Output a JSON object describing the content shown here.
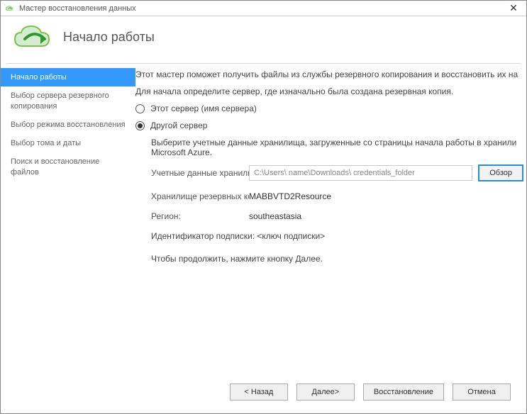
{
  "titlebar": {
    "title": "Мастер восстановления данных"
  },
  "header": {
    "heading": "Начало работы"
  },
  "sidebar": {
    "steps": [
      "Начало работы",
      "Выбор сервера резервного копирования",
      "Выбор режима восстановления",
      "Выбор тома и даты",
      "Поиск и восстановление файлов"
    ]
  },
  "content": {
    "intro": "Этот мастер поможет получить файлы из службы резервного копирования и восстановить их на",
    "define_server": "Для начала определите сервер, где изначально была создана резервная копия.",
    "radio_this_server": "Этот сервер (имя сервера)",
    "radio_other_server": "Другой сервер",
    "creds_hint": "Выберите учетные данные хранилища, загруженные со страницы начала работы в хранили Microsoft Azure.",
    "creds_label": "Учетные данные хранилища:",
    "creds_path": "C:\\Users\\ name\\Downloads\\ credentials_folder",
    "browse": "Обзор",
    "vault_label": "Хранилище резервных копий:",
    "vault_value": "MABBVTD2Resource",
    "region_label": "Регион:",
    "region_value": "southeastasia",
    "sub_id_label": "Идентификатор подписки: <ключ подписки>",
    "continue_hint": "Чтобы продолжить, нажмите кнопку Далее."
  },
  "footer": {
    "back": "< Назад",
    "next": "Далее>",
    "recover": "Восстановление",
    "cancel": "Отмена"
  }
}
